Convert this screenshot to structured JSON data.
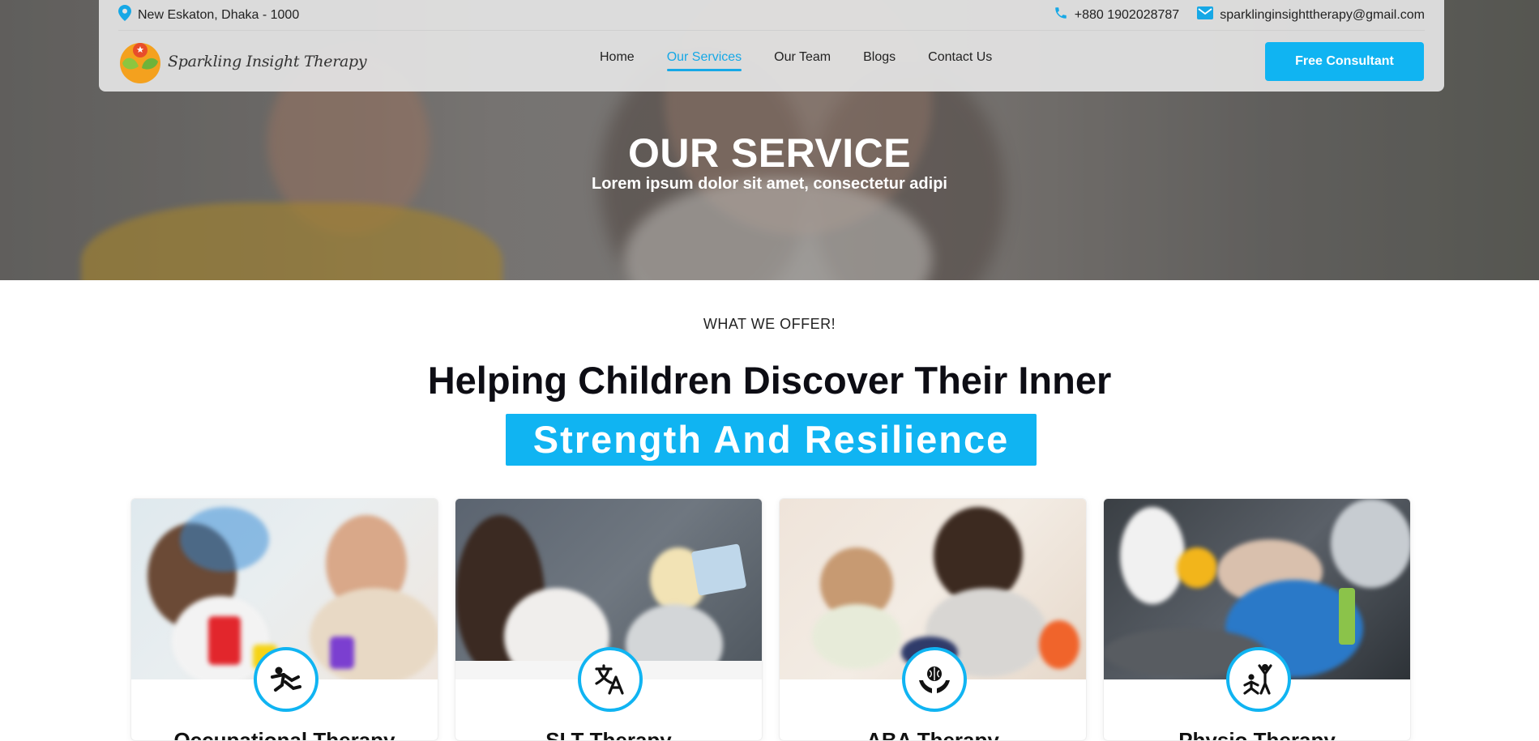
{
  "header": {
    "address": "New Eskaton, Dhaka - 1000",
    "phone": "+880 1902028787",
    "email": "sparklinginsighttherapy@gmail.com",
    "logo_text": "Sparkling Insight Therapy",
    "nav": [
      {
        "label": "Home",
        "active": false
      },
      {
        "label": "Our Services",
        "active": true
      },
      {
        "label": "Our Team",
        "active": false
      },
      {
        "label": "Blogs",
        "active": false
      },
      {
        "label": "Contact Us",
        "active": false
      }
    ],
    "cta_label": "Free Consultant"
  },
  "hero": {
    "title": "OUR SERVICE",
    "subtitle": "Lorem ipsum dolor sit amet, consectetur adipi"
  },
  "offer": {
    "eyebrow": "WHAT WE OFFER!",
    "headline": "Helping Children Discover Their Inner",
    "highlight": "Strength And Resilience"
  },
  "services": [
    {
      "title": "Occupational Therapy",
      "icon": "climbing-person-icon"
    },
    {
      "title": "SLT Therapy",
      "icon": "translate-icon"
    },
    {
      "title": "ABA Therapy",
      "icon": "brain-hands-icon"
    },
    {
      "title": "Physio Therapy",
      "icon": "exercise-people-icon"
    }
  ],
  "colors": {
    "accent": "#10b4f2",
    "nav_active": "#16a8e6",
    "text_dark": "#0d0d14"
  }
}
